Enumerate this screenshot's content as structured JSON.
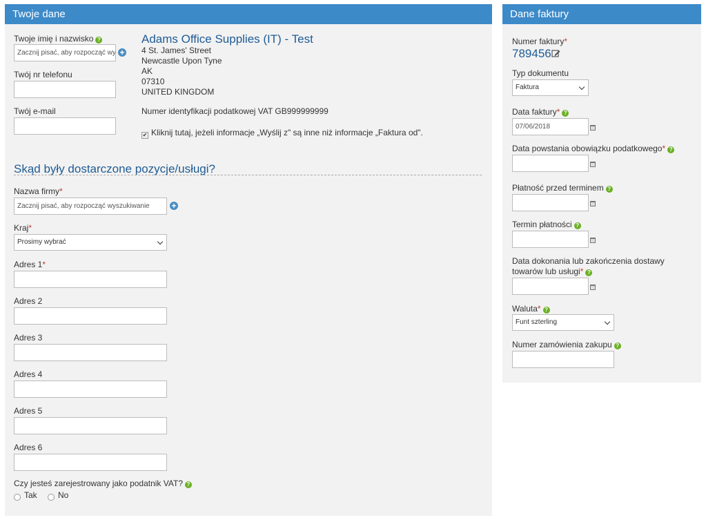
{
  "left_panel": {
    "title": "Twoje dane",
    "name_label": "Twoje imię i nazwisko",
    "name_placeholder": "Zacznij pisać, aby rozpocząć wyszukiwanie",
    "phone_label": "Twój nr telefonu",
    "email_label": "Twój e-mail",
    "company": {
      "name": "Adams Office Supplies (IT) - Test",
      "address_lines": [
        "4 St. James' Street",
        "Newcastle Upon Tyne",
        "AK",
        "07310",
        "UNITED KINGDOM"
      ],
      "vat_text": "Numer identyfikacji podatkowej VAT GB999999999",
      "checkbox_label": "Kliknij tutaj, jeżeli informacje „Wyślij z\" są inne niż informacje „Faktura od\"."
    },
    "ship_section": {
      "title": "Skąd były dostarczone pozycje/usługi?",
      "company_label": "Nazwa firmy",
      "company_placeholder": "Zacznij pisać, aby rozpocząć wyszukiwanie",
      "country_label": "Kraj",
      "country_value": "Prosimy wybrać",
      "address_labels": [
        "Adres 1",
        "Adres 2",
        "Adres 3",
        "Adres 4",
        "Adres 5",
        "Adres 6"
      ],
      "vat_question": "Czy jesteś zarejestrowany jako podatnik VAT?",
      "vat_yes": "Tak",
      "vat_no": "No"
    }
  },
  "right_panel": {
    "title": "Dane faktury",
    "invoice_number_label": "Numer faktury",
    "invoice_number": "789456",
    "doc_type_label": "Typ dokumentu",
    "doc_type_value": "Faktura",
    "invoice_date_label": "Data faktury",
    "invoice_date_value": "07/06/2018",
    "tax_point_label": "Data powstania obowiązku podatkowego",
    "early_payment_label": "Płatność przed terminem",
    "due_date_label": "Termin płatności",
    "delivery_date_label_1": "Data dokonania lub zakończenia dostawy",
    "delivery_date_label_2": "towarów lub usługi",
    "currency_label": "Waluta",
    "currency_value": "Funt szterling",
    "po_label": "Numer zamówienia zakupu"
  },
  "colors": {
    "header_blue": "#3d8ac9",
    "title_blue": "#1f5b94",
    "help_green": "#6ab023",
    "required_red": "#c0392b"
  }
}
